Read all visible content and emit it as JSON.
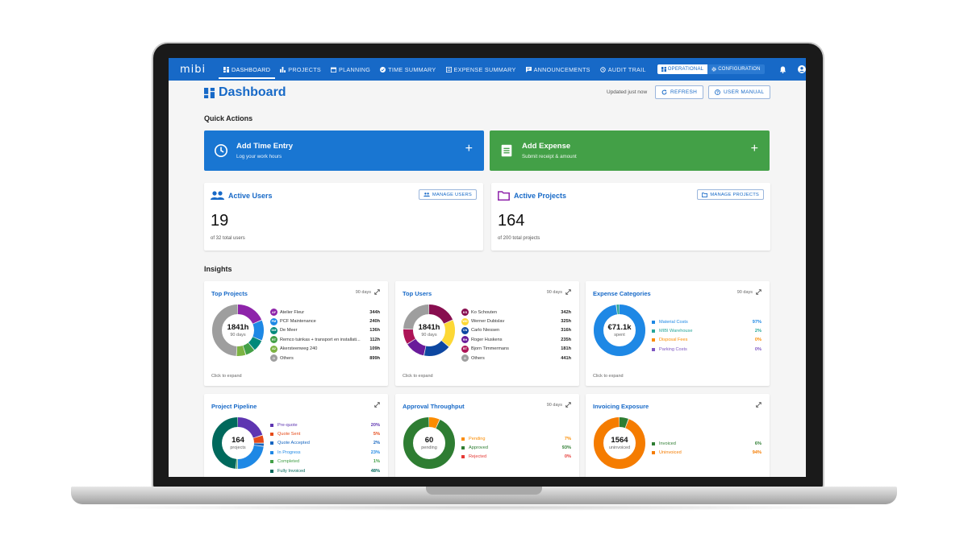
{
  "nav": {
    "logo": "mibi",
    "items": [
      {
        "label": "Dashboard",
        "icon": "dashboard-icon"
      },
      {
        "label": "Projects",
        "icon": "bar-chart-icon"
      },
      {
        "label": "Planning",
        "icon": "calendar-icon"
      },
      {
        "label": "Time Summary",
        "icon": "check-circle-icon"
      },
      {
        "label": "Expense Summary",
        "icon": "receipt-icon"
      },
      {
        "label": "Announcements",
        "icon": "chat-icon"
      },
      {
        "label": "Audit Trail",
        "icon": "history-icon"
      }
    ],
    "operational": "OPERATIONAL",
    "configuration": "CONFIGURATION"
  },
  "header": {
    "title": "Dashboard",
    "updated": "Updated just now",
    "refresh": "REFRESH",
    "user_manual": "USER MANUAL"
  },
  "quick_actions": {
    "title": "Quick Actions",
    "time": {
      "title": "Add Time Entry",
      "subtitle": "Log your work hours",
      "color": "#1976d2"
    },
    "expense": {
      "title": "Add Expense",
      "subtitle": "Submit receipt & amount",
      "color": "#43a047"
    }
  },
  "stats": {
    "users": {
      "title": "Active Users",
      "value": "19",
      "sub": "of 32 total users",
      "button": "MANAGE USERS"
    },
    "projects": {
      "title": "Active Projects",
      "value": "164",
      "sub": "of 200 total projects",
      "button": "MANAGE PROJECTS"
    }
  },
  "insights": {
    "title": "Insights",
    "click_to_expand": "Click to expand",
    "top_projects": {
      "title": "Top Projects",
      "days": "90 days",
      "center_value": "1841h",
      "center_label": "90 days",
      "rows": [
        {
          "initials": "AF",
          "name": "Atelier Fleur",
          "value": "344h",
          "color": "#8e24aa"
        },
        {
          "initials": "PM",
          "name": "PCF Maintenance",
          "value": "240h",
          "color": "#1e88e5"
        },
        {
          "initials": "DM",
          "name": "De Meer",
          "value": "136h",
          "color": "#00897b"
        },
        {
          "initials": "RT",
          "name": "Remco tuinkas + transport en installati...",
          "value": "112h",
          "color": "#43a047"
        },
        {
          "initials": "A2",
          "name": "Akersteenweg 240",
          "value": "109h",
          "color": "#7cb342"
        },
        {
          "initials": "O",
          "name": "Others",
          "value": "899h",
          "color": "#9e9e9e"
        }
      ]
    },
    "top_users": {
      "title": "Top Users",
      "days": "90 days",
      "center_value": "1841h",
      "center_label": "90 days",
      "rows": [
        {
          "initials": "KS",
          "name": "Ko Schouten",
          "value": "342h",
          "color": "#880e4f"
        },
        {
          "initials": "WD",
          "name": "Werner Dubislav",
          "value": "325h",
          "color": "#fdd835"
        },
        {
          "initials": "CN",
          "name": "Carlo Niessen",
          "value": "316h",
          "color": "#0d47a1"
        },
        {
          "initials": "RH",
          "name": "Roger Huskens",
          "value": "235h",
          "color": "#6a1b9a"
        },
        {
          "initials": "BT",
          "name": "Bjorn Timmermans",
          "value": "181h",
          "color": "#ad1457"
        },
        {
          "initials": "O",
          "name": "Others",
          "value": "441h",
          "color": "#9e9e9e"
        }
      ]
    },
    "expense_categories": {
      "title": "Expense Categories",
      "days": "90 days",
      "center_value": "€71.1k",
      "center_label": "spent",
      "rows": [
        {
          "name": "Material Costs",
          "value": "97%",
          "color": "#1e88e5"
        },
        {
          "name": "MIBI Warehouse",
          "value": "2%",
          "color": "#26a69a"
        },
        {
          "name": "Disposal Fees",
          "value": "0%",
          "color": "#fb8c00"
        },
        {
          "name": "Parking Costs",
          "value": "0%",
          "color": "#7e57c2"
        }
      ]
    },
    "project_pipeline": {
      "title": "Project Pipeline",
      "center_value": "164",
      "center_label": "projects",
      "rows": [
        {
          "name": "Pre-quote",
          "value": "20%",
          "color": "#5e35b1"
        },
        {
          "name": "Quote Sent",
          "value": "5%",
          "color": "#e64a19"
        },
        {
          "name": "Quote Accepted",
          "value": "2%",
          "color": "#1565c0"
        },
        {
          "name": "In Progress",
          "value": "23%",
          "color": "#1e88e5"
        },
        {
          "name": "Completed",
          "value": "1%",
          "color": "#43a047"
        },
        {
          "name": "Fully Invoiced",
          "value": "48%",
          "color": "#00695c"
        }
      ]
    },
    "approval_throughput": {
      "title": "Approval Throughput",
      "days": "90 days",
      "center_value": "60",
      "center_label": "pending",
      "rows": [
        {
          "name": "Pending",
          "value": "7%",
          "color": "#fb8c00"
        },
        {
          "name": "Approved",
          "value": "93%",
          "color": "#2e7d32"
        },
        {
          "name": "Rejected",
          "value": "0%",
          "color": "#e53935"
        }
      ]
    },
    "invoicing_exposure": {
      "title": "Invoicing Exposure",
      "center_value": "1564",
      "center_label": "uninvoiced",
      "rows": [
        {
          "name": "Invoiced",
          "value": "6%",
          "color": "#2e7d32"
        },
        {
          "name": "Uninvoiced",
          "value": "94%",
          "color": "#f57c00"
        }
      ]
    }
  }
}
